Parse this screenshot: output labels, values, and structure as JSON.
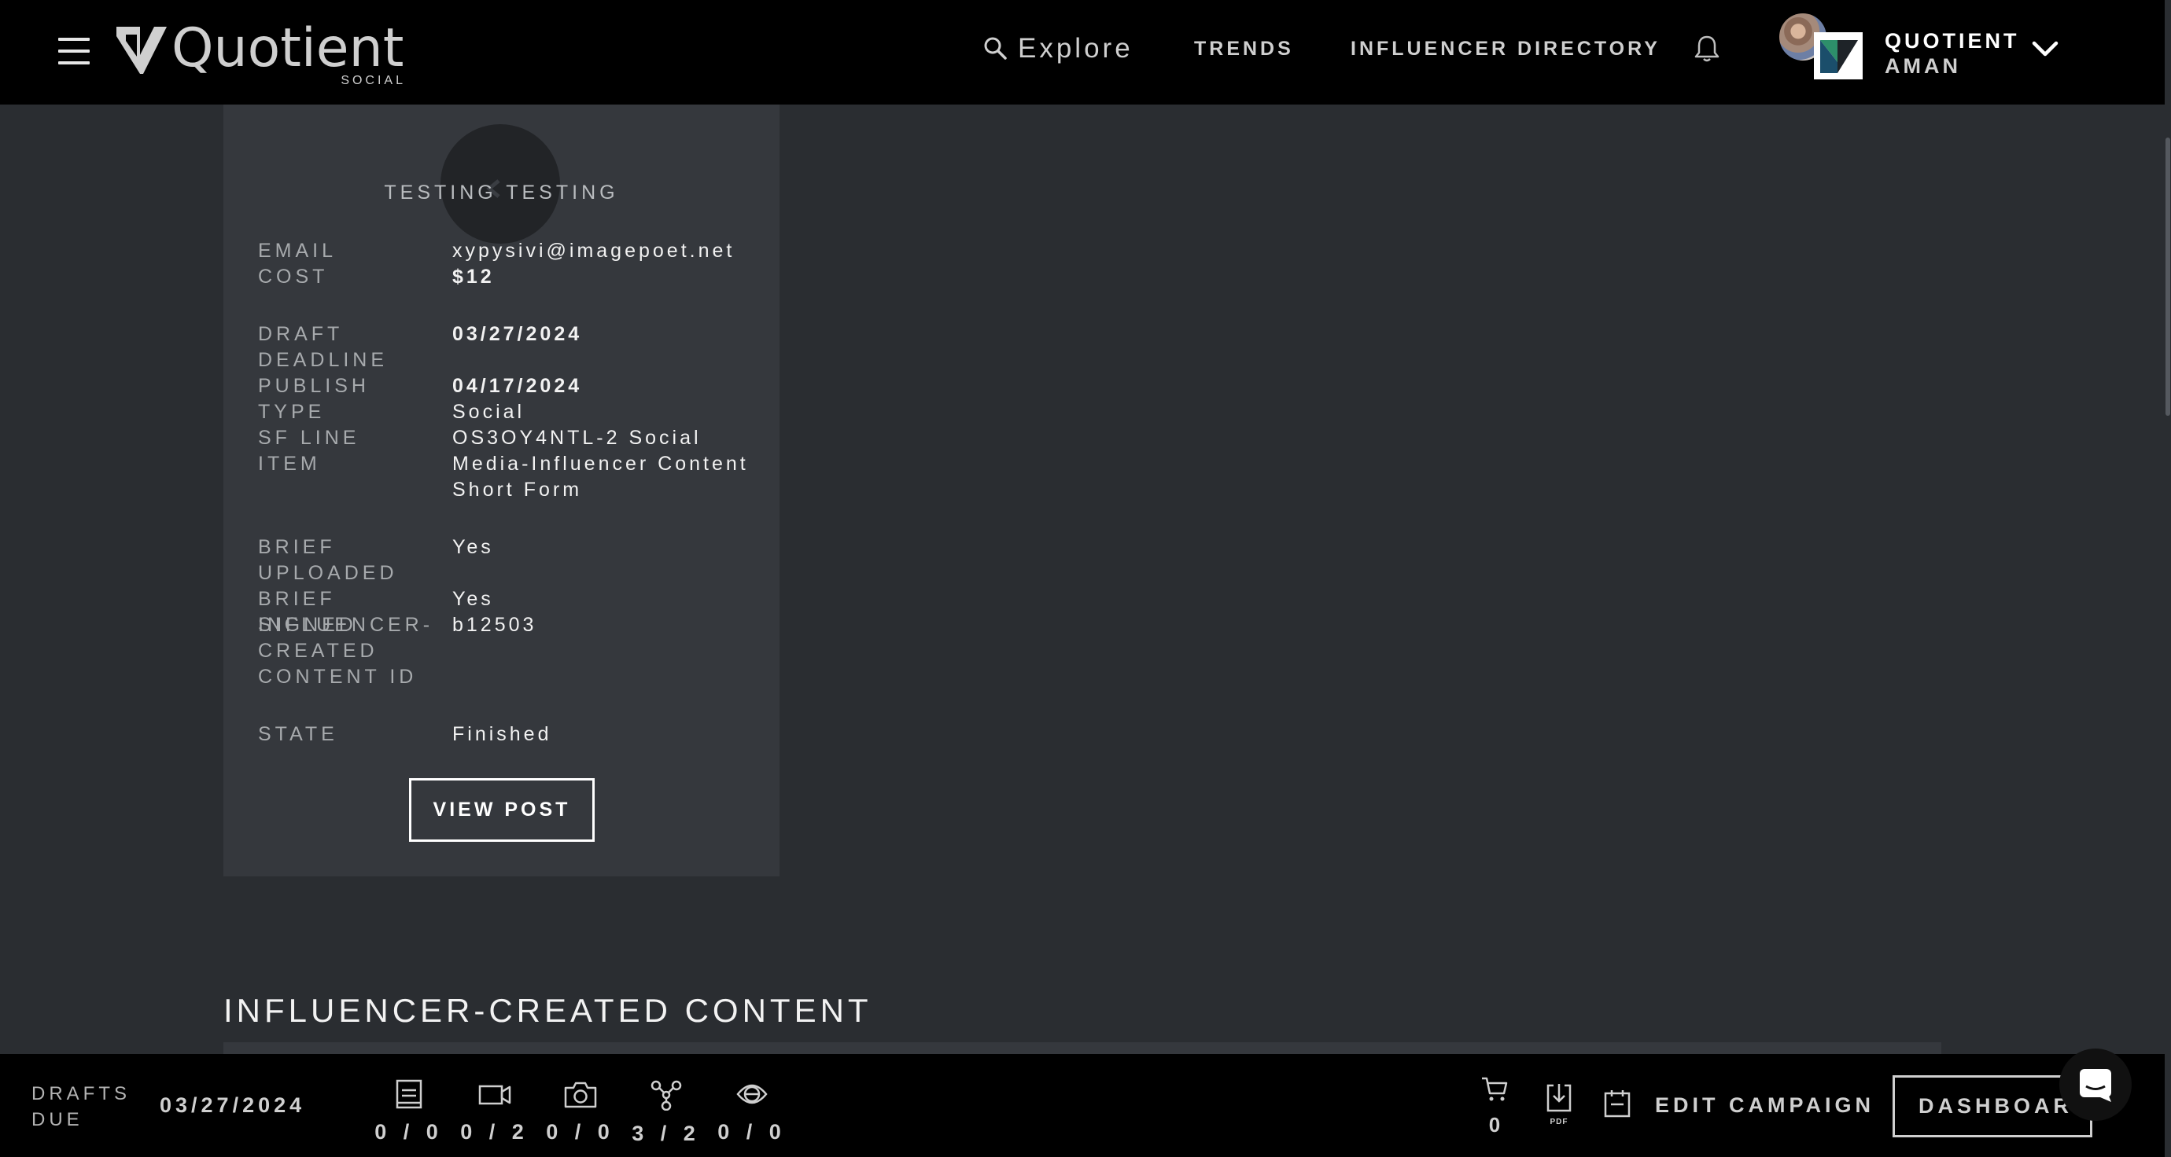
{
  "header": {
    "logo": {
      "word": "Quotient",
      "sub": "SOCIAL"
    },
    "nav": {
      "explore": "Explore",
      "trends": "TRENDS",
      "directory": "INFLUENCER DIRECTORY"
    },
    "account": {
      "name": "QUOTIENT",
      "user": "AMAN"
    },
    "icons": [
      "menu-icon",
      "search-icon",
      "bell-icon",
      "chevron-down-icon"
    ]
  },
  "card": {
    "title": "TESTING TESTING",
    "fields": [
      {
        "label": "EMAIL",
        "value": "xypysivi@imagepoet.net"
      },
      {
        "label": "COST",
        "value": "$12"
      },
      {
        "label": "DRAFT DEADLINE",
        "value": "03/27/2024"
      },
      {
        "label": "PUBLISH",
        "value": "04/17/2024"
      },
      {
        "label": "TYPE",
        "value": "Social"
      },
      {
        "label": "SF LINE ITEM",
        "value": "OS3OY4NTL-2 Social Media-Influencer Content Short Form"
      },
      {
        "label": "BRIEF UPLOADED",
        "value": "Yes"
      },
      {
        "label": "BRIEF SIGNED",
        "value": "Yes"
      },
      {
        "label": "INFLUENCER-CREATED CONTENT ID",
        "value": "b12503"
      },
      {
        "label": "STATE",
        "value": "Finished"
      }
    ],
    "button": "VIEW POST"
  },
  "section": {
    "title": "INFLUENCER-CREATED CONTENT"
  },
  "footer": {
    "drafts_label": "DRAFTS DUE",
    "drafts_date": "03/27/2024",
    "stats": [
      {
        "icon": "blog-icon",
        "value": "0 / 0"
      },
      {
        "icon": "video-icon",
        "value": "0 / 2"
      },
      {
        "icon": "camera-icon",
        "value": "0 / 0"
      },
      {
        "icon": "social-network-icon",
        "value": "3 / 2"
      },
      {
        "icon": "target-icon",
        "value": "0 / 0"
      }
    ],
    "cart_count": "0",
    "pdf_label": "PDF",
    "edit_campaign": "EDIT CAMPAIGN",
    "dashboard": "DASHBOARD"
  }
}
